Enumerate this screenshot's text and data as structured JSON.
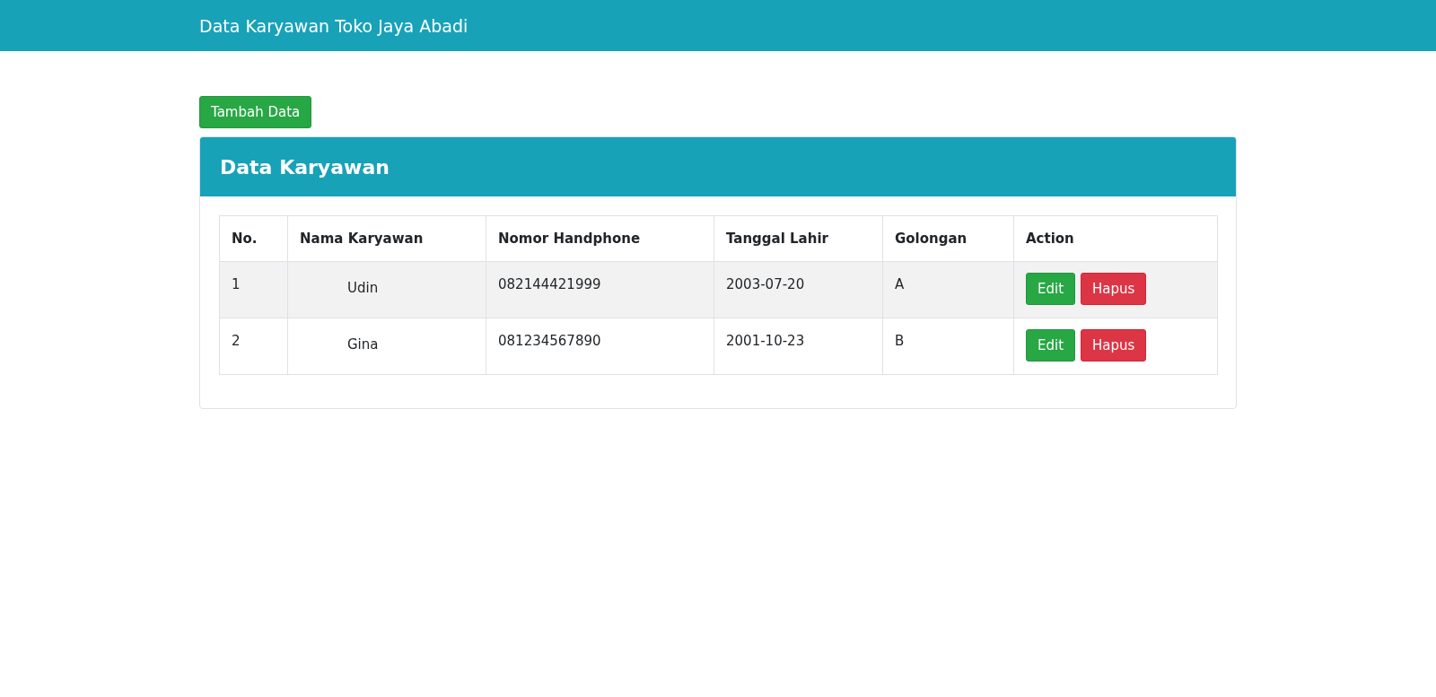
{
  "navbar": {
    "brand": "Data Karyawan Toko Jaya Abadi"
  },
  "add_button": "Tambah Data",
  "card": {
    "title": "Data Karyawan"
  },
  "table": {
    "columns": [
      "No.",
      "Nama Karyawan",
      "Nomor Handphone",
      "Tanggal Lahir",
      "Golongan",
      "Action"
    ],
    "rows": [
      {
        "no": "1",
        "name": "Udin",
        "phone": "082144421999",
        "birth_date": "2003-07-20",
        "grade": "A",
        "actions": [
          "Edit",
          "Hapus"
        ]
      },
      {
        "no": "2",
        "name": "Gina",
        "phone": "081234567890",
        "birth_date": "2001-10-23",
        "grade": "B",
        "actions": [
          "Edit",
          "Hapus"
        ]
      }
    ]
  }
}
